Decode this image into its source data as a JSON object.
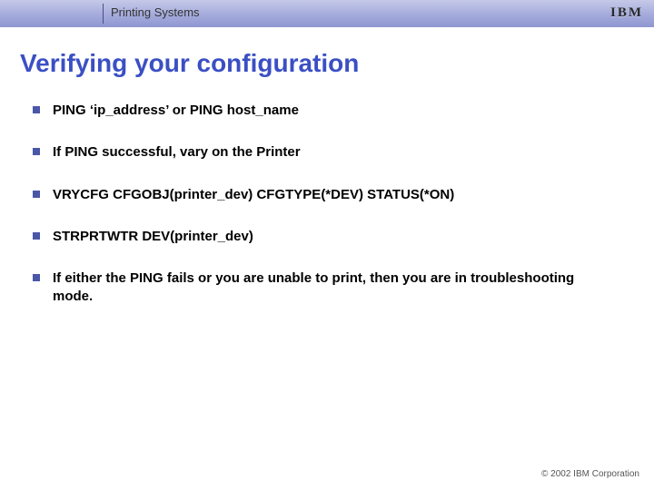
{
  "header": {
    "section_label": "Printing Systems",
    "logo_text": "IBM"
  },
  "title": "Verifying your configuration",
  "bullets": [
    "PING ‘ip_address’ or PING host_name",
    "If PING successful, vary on the Printer",
    "VRYCFG CFGOBJ(printer_dev) CFGTYPE(*DEV) STATUS(*ON)",
    "STRPRTWTR DEV(printer_dev)",
    "If either the PING fails or you are unable to print, then you are in troubleshooting mode."
  ],
  "footer": {
    "copyright": "© 2002 IBM Corporation"
  }
}
